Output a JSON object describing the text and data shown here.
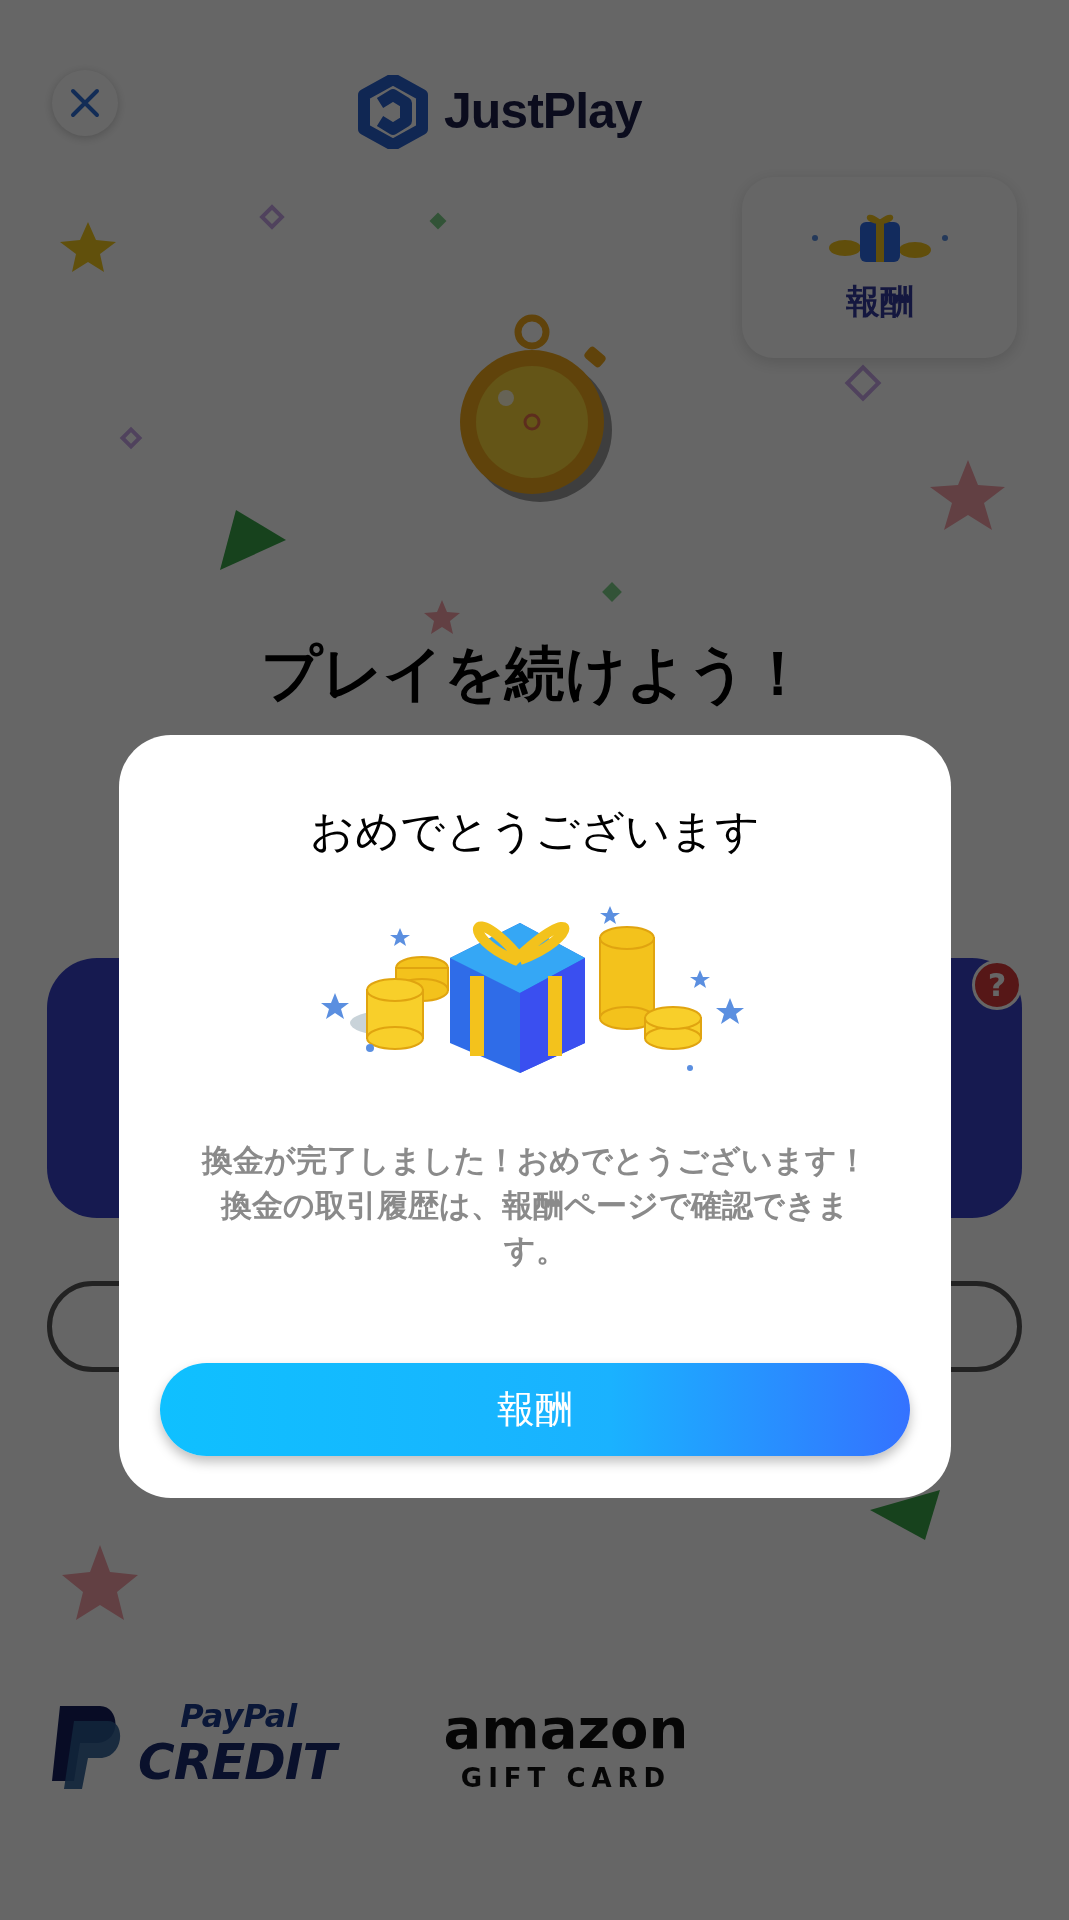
{
  "header": {
    "logo_text": "JustPlay"
  },
  "rewards_card": {
    "label": "報酬"
  },
  "heading": "プレイを続けよう！",
  "help_badge": "?",
  "partners": [
    {
      "kind": "paypal",
      "line1": "PayPal",
      "line2": "CREDIT"
    },
    {
      "kind": "amazon",
      "line1": "amazon",
      "line2": "GIFT CARD"
    }
  ],
  "dialog": {
    "title": "おめでとうございます",
    "message": "換金が完了しました！おめでとうございます！換金の取引履歴は、報酬ページで確認できます。",
    "button": "報酬"
  }
}
